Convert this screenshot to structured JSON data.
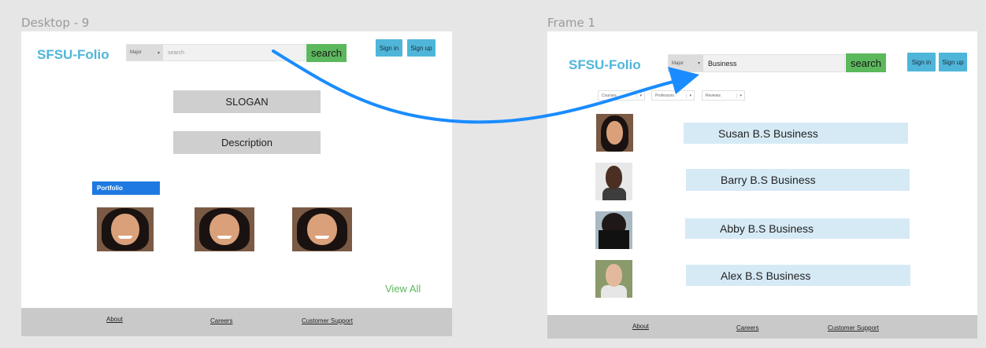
{
  "frames": {
    "left": {
      "label": "Desktop - 9",
      "logo": "SFSU-Folio",
      "major_label": "Major",
      "search_placeholder": "search",
      "search_button": "search",
      "sign_in": "Sign in",
      "sign_up": "Sign up",
      "slogan": "SLOGAN",
      "description": "Description",
      "portfolio": "Portfolio",
      "view_all": "View All",
      "footer": {
        "about": "About",
        "careers": "Careers",
        "support": "Customer Support"
      }
    },
    "right": {
      "label": "Frame 1",
      "logo": "SFSU-Folio",
      "major_label": "Major",
      "search_value": "Business",
      "search_button": "search",
      "sign_in": "Sign in",
      "sign_up": "Sign up",
      "filters": [
        "Courses",
        "Professors",
        "Reviews"
      ],
      "results": [
        {
          "name": "Susan B.S Business"
        },
        {
          "name": "Barry B.S Business"
        },
        {
          "name": "Abby B.S Business"
        },
        {
          "name": "Alex B.S Business"
        }
      ],
      "footer": {
        "about": "About",
        "careers": "Careers",
        "support": "Customer Support"
      }
    }
  },
  "colors": {
    "canvas": "#e6e6e6",
    "logo": "#4fb6da",
    "search_button": "#5cb85c",
    "auth_button": "#4fb6da",
    "portfolio": "#1e7ae0",
    "result_box": "#d6eaf6",
    "arrow": "#1a8cff",
    "footer": "#c9c9c9"
  }
}
